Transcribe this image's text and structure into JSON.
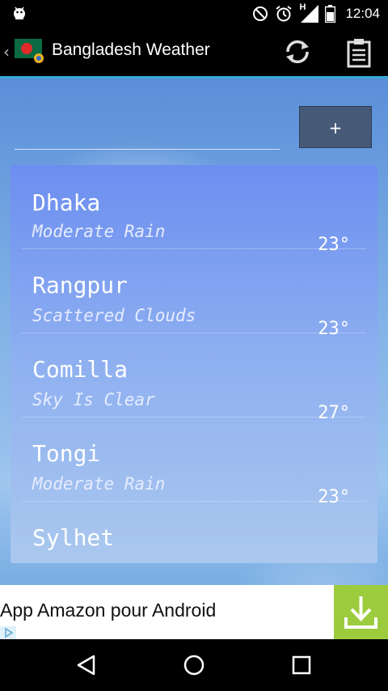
{
  "status_bar": {
    "time": "12:04",
    "icons": [
      "android-debug-icon",
      "do-not-disturb-icon",
      "alarm-icon",
      "signal-h-icon",
      "battery-icon"
    ],
    "signal_label": "H"
  },
  "action_bar": {
    "title": "Bangladesh Weather",
    "icons": [
      "bangladesh-flag-icon",
      "refresh-icon",
      "clipboard-icon"
    ]
  },
  "search": {
    "placeholder": "",
    "value": "",
    "add_label": "+"
  },
  "cities": [
    {
      "name": "Dhaka",
      "condition": "Moderate Rain",
      "temp": "23°"
    },
    {
      "name": "Rangpur",
      "condition": "Scattered Clouds",
      "temp": "23°"
    },
    {
      "name": "Comilla",
      "condition": "Sky Is Clear",
      "temp": "27°"
    },
    {
      "name": "Tongi",
      "condition": "Moderate Rain",
      "temp": "23°"
    },
    {
      "name": "Sylhet",
      "condition": "",
      "temp": ""
    }
  ],
  "ad": {
    "text": "App Amazon pour Android",
    "accent": "#9ccb3e"
  },
  "colors": {
    "action_bar_accent": "#33a9d8",
    "add_button": "#465a78"
  }
}
